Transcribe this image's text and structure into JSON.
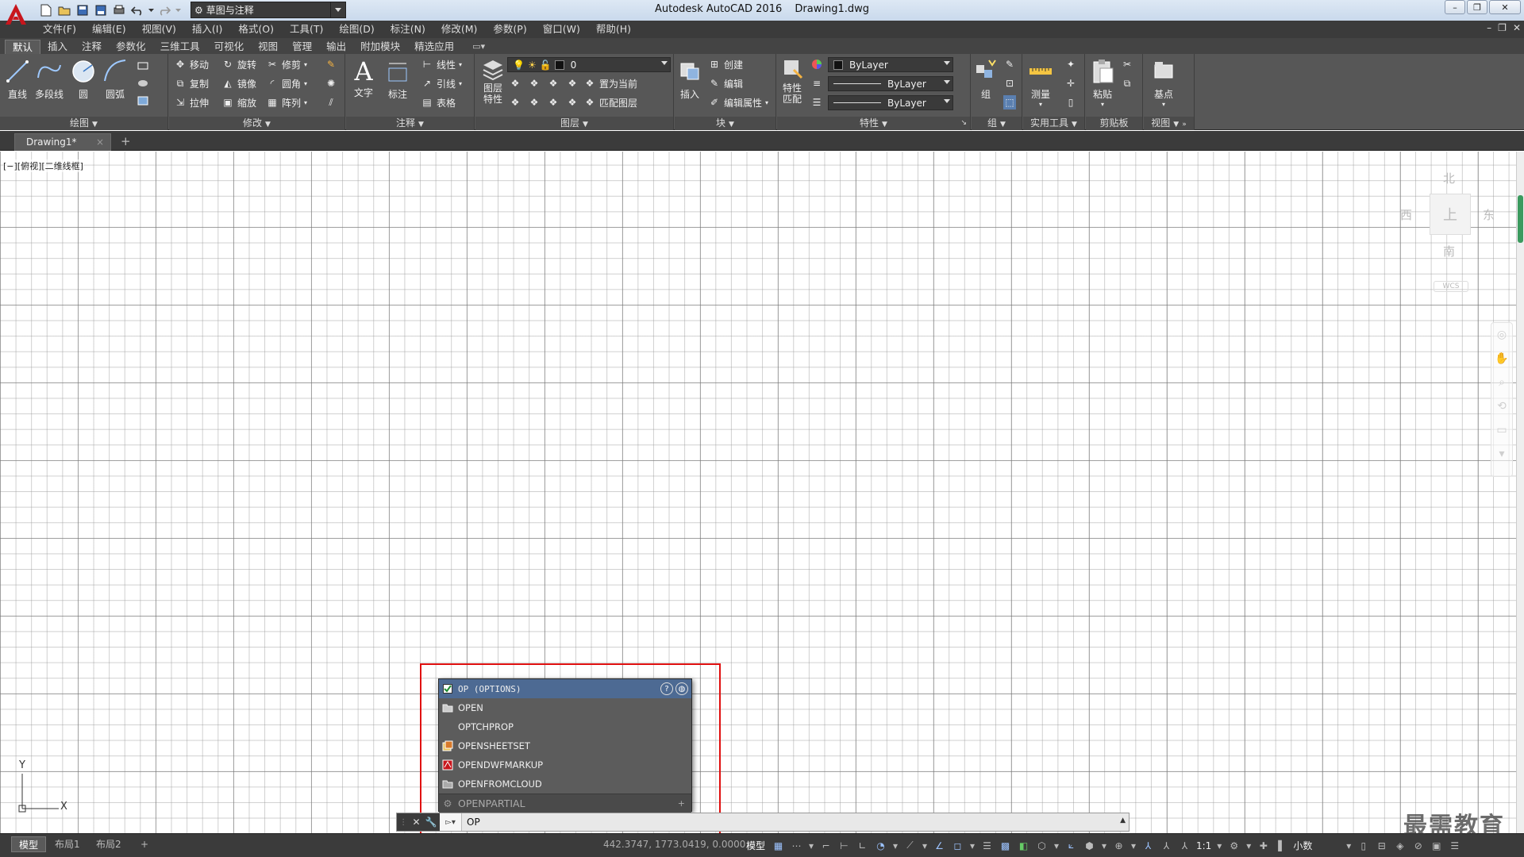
{
  "workspace": {
    "name": "草图与注释"
  },
  "window": {
    "app_title": "Autodesk AutoCAD 2016",
    "doc_title": "Drawing1.dwg",
    "minimize": "–",
    "restore": "❐",
    "close": "✕"
  },
  "menubar": {
    "items": [
      "文件(F)",
      "编辑(E)",
      "视图(V)",
      "插入(I)",
      "格式(O)",
      "工具(T)",
      "绘图(D)",
      "标注(N)",
      "修改(M)",
      "参数(P)",
      "窗口(W)",
      "帮助(H)"
    ]
  },
  "ribbon_tabs": {
    "items": [
      "默认",
      "插入",
      "注释",
      "参数化",
      "三维工具",
      "可视化",
      "视图",
      "管理",
      "输出",
      "附加模块",
      "精选应用"
    ],
    "active": "默认"
  },
  "ribbon": {
    "draw": {
      "title": "绘图",
      "line": "直线",
      "polyline": "多段线",
      "circle": "圆",
      "arc": "圆弧"
    },
    "modify": {
      "title": "修改",
      "move": "移动",
      "rotate": "旋转",
      "trim": "修剪",
      "copy": "复制",
      "mirror": "镜像",
      "fillet": "圆角",
      "stretch": "拉伸",
      "scale": "缩放",
      "array": "阵列"
    },
    "annotation": {
      "title": "注释",
      "text": "文字",
      "dimension": "标注",
      "linear": "线性",
      "leader": "引线",
      "table": "表格"
    },
    "layers": {
      "title": "图层",
      "layer_props": "图层特性",
      "current_layer": "0",
      "set_current": "置为当前",
      "match_layer": "匹配图层"
    },
    "block": {
      "title": "块",
      "insert": "插入",
      "create": "创建",
      "edit": "编辑",
      "edit_attr": "编辑属性"
    },
    "properties": {
      "title": "特性",
      "match": "特性匹配",
      "color": "ByLayer",
      "linetype": "ByLayer",
      "lineweight": "ByLayer"
    },
    "groups": {
      "title": "组",
      "group": "组"
    },
    "utilities": {
      "title": "实用工具",
      "measure": "测量"
    },
    "clipboard": {
      "title": "剪贴板",
      "paste": "粘贴"
    },
    "view": {
      "title": "视图",
      "basepoint": "基点"
    }
  },
  "file_tabs": {
    "drawing": "Drawing1*",
    "close": "×",
    "add": "+"
  },
  "canvas": {
    "viewport_label": "[−][俯视][二维线框]"
  },
  "navcube": {
    "north": "北",
    "south": "南",
    "east": "东",
    "west": "西",
    "face": "上",
    "wcs": "WCS"
  },
  "ucs": {
    "x": "X",
    "y": "Y"
  },
  "autocomplete": {
    "items": [
      "OP (OPTIONS)",
      "OPEN",
      "OPTCHPROP",
      "OPENSHEETSET",
      "OPENDWFMARKUP",
      "OPENFROMCLOUD",
      "OPENPARTIAL"
    ],
    "help": "?",
    "expand": "+"
  },
  "command_line": {
    "text": "OP"
  },
  "layout_tabs": {
    "items": [
      "模型",
      "布局1",
      "布局2"
    ],
    "add": "+"
  },
  "status": {
    "coords": "442.3747, 1773.0419, 0.0000",
    "model": "模型",
    "scale": "1:1",
    "units": "小数"
  },
  "watermark": {
    "text": "最需教育"
  }
}
